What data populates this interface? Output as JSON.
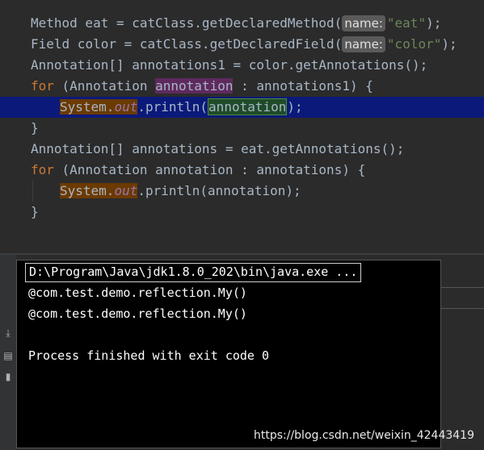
{
  "editor": {
    "line1": {
      "type": "Method",
      "rest": " eat = catClass.getDeclaredMethod(",
      "hint": "name:",
      "arg": "\"eat\"",
      "end": ");"
    },
    "line2": {
      "type": "Field",
      "rest": " color = catClass.getDeclaredField(",
      "hint": "name:",
      "arg": "\"color\"",
      "end": ");"
    },
    "line3": {
      "text": "Annotation[] annotations1 = color.getAnnotations();"
    },
    "line4": {
      "kw": "for",
      "pre": " (Annotation ",
      "var": "annotation",
      "post": " : annotations1) {"
    },
    "line5": {
      "cls": "System.",
      "field": "out",
      "mid": ".println(",
      "param": "annotation",
      "end": ");"
    },
    "line6": {
      "text": "}"
    },
    "line7": {
      "text": "Annotation[] annotations = eat.getAnnotations();"
    },
    "line8": {
      "kw": "for",
      "rest": " (Annotation annotation : annotations) {"
    },
    "line9": {
      "cls": "System.",
      "field": "out",
      "mid": ".println(annotation);"
    },
    "line10": {
      "text": "}"
    }
  },
  "console": {
    "command": "D:\\Program\\Java\\jdk1.8.0_202\\bin\\java.exe ...",
    "output1": "@com.test.demo.reflection.My()",
    "output2": "@com.test.demo.reflection.My()",
    "exit": "Process finished with exit code 0"
  },
  "sidebar_icons": [
    "scroll-end-icon",
    "print-icon",
    "trash-icon"
  ],
  "watermark": "https://blog.csdn.net/weixin_42443419",
  "colors": {
    "editor_bg": "#2b2b2b",
    "keyword": "#cc7832",
    "current_line": "#0b1a7a",
    "console_bg": "#000000"
  }
}
